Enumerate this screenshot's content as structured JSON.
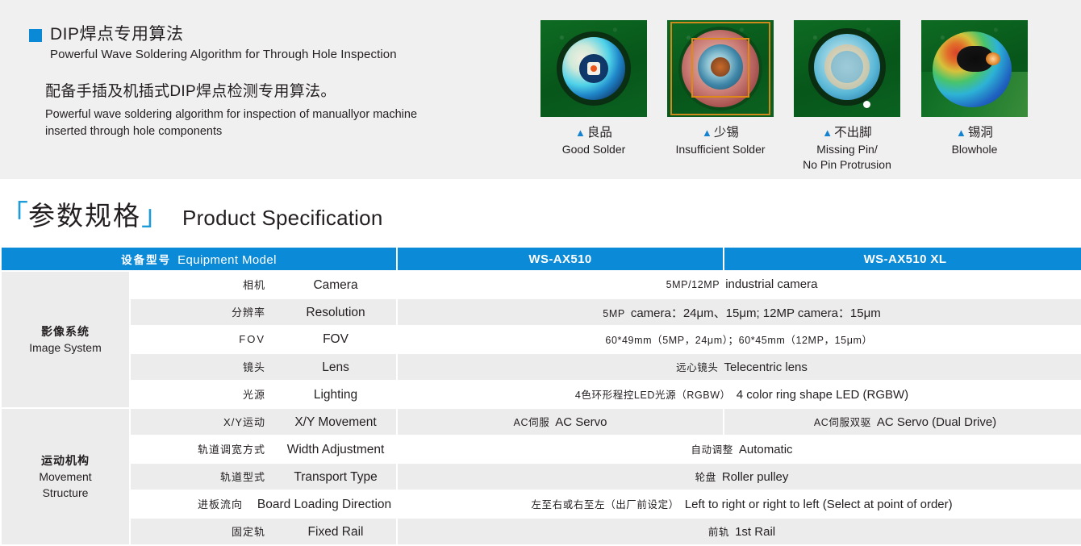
{
  "feature": {
    "title_cn": "DIP焊点专用算法",
    "title_en": "Powerful Wave Soldering Algorithm for Through Hole Inspection",
    "sub_cn": "配备手插及机插式DIP焊点检测专用算法。",
    "sub_en": "Powerful wave soldering algorithm for inspection of manuallyor machine inserted through hole components",
    "bullet_color": "#0a8ad6"
  },
  "samples": [
    {
      "caption_cn": "良品",
      "caption_en": "Good Solder",
      "marker": "▲"
    },
    {
      "caption_cn": "少锡",
      "caption_en": "Insufficient Solder",
      "marker": "▲"
    },
    {
      "caption_cn": "不出脚",
      "caption_en": "Missing Pin/\nNo Pin Protrusion",
      "marker": "▲"
    },
    {
      "caption_cn": "锡洞",
      "caption_en": "Blowhole",
      "marker": "▲"
    }
  ],
  "sample_captions": {
    "s0_en": "Good Solder",
    "s1_en": "Insufficient Solder",
    "s2_en_line1": "Missing Pin/",
    "s2_en_line2": "No Pin Protrusion",
    "s3_en": "Blowhole"
  },
  "spec": {
    "bracket_open": "「",
    "bracket_close": "」",
    "title_cn": "参数规格",
    "title_en": "Product Specification",
    "header_color": "#0b8ad8"
  },
  "table": {
    "header": {
      "model_cn": "设备型号",
      "model_en": "Equipment Model",
      "col1": "WS-AX510",
      "col2": "WS-AX510 XL"
    },
    "groups": [
      {
        "cn": "影像系统",
        "en": "Image System",
        "rows": [
          {
            "label_cn": "相机",
            "label_en": "Camera",
            "merged": true,
            "value_cn": "5MP/12MP",
            "value_en": "industrial camera",
            "shade": "w"
          },
          {
            "label_cn": "分辨率",
            "label_en": "Resolution",
            "merged": true,
            "value_cn": "5MP",
            "value_en": "camera：24μm、15μm; 12MP camera：15μm",
            "shade": "g"
          },
          {
            "label_cn": "FOV",
            "label_en": "FOV",
            "merged": true,
            "value_cn": "60*49mm（5MP，24μm）；60*45mm（12MP，15μm）",
            "value_en": "",
            "shade": "w"
          },
          {
            "label_cn": "镜头",
            "label_en": "Lens",
            "merged": true,
            "value_cn": "远心镜头",
            "value_en": "Telecentric lens",
            "shade": "g"
          },
          {
            "label_cn": "光源",
            "label_en": "Lighting",
            "merged": true,
            "value_cn": "4色环形程控LED光源（RGBW）",
            "value_en": "4 color ring shape LED (RGBW)",
            "shade": "w"
          }
        ]
      },
      {
        "cn": "运动机构",
        "en": "Movement\nStructure",
        "en_line1": "Movement",
        "en_line2": "Structure",
        "rows": [
          {
            "label_cn": "X/Y运动",
            "label_en": "X/Y Movement",
            "merged": false,
            "value_cn": "AC伺服",
            "value_en": "AC Servo",
            "value2_cn": "AC伺服双驱",
            "value2_en": "AC Servo (Dual Drive)",
            "shade": "g"
          },
          {
            "label_cn": "轨道调宽方式",
            "label_en": "Width Adjustment",
            "merged": true,
            "value_cn": "自动调整",
            "value_en": "Automatic",
            "shade": "w"
          },
          {
            "label_cn": "轨道型式",
            "label_en": "Transport Type",
            "merged": true,
            "value_cn": "轮盘",
            "value_en": "Roller pulley",
            "shade": "g"
          },
          {
            "label_cn": "进板流向",
            "label_en": "Board Loading Direction",
            "merged": true,
            "value_cn": "左至右或右至左（出厂前设定）",
            "value_en": "Left to right or right to left (Select at point of order)",
            "shade": "w"
          },
          {
            "label_cn": "固定轨",
            "label_en": "Fixed Rail",
            "merged": true,
            "value_cn": "前轨",
            "value_en": "1st Rail",
            "shade": "g"
          }
        ]
      }
    ]
  }
}
